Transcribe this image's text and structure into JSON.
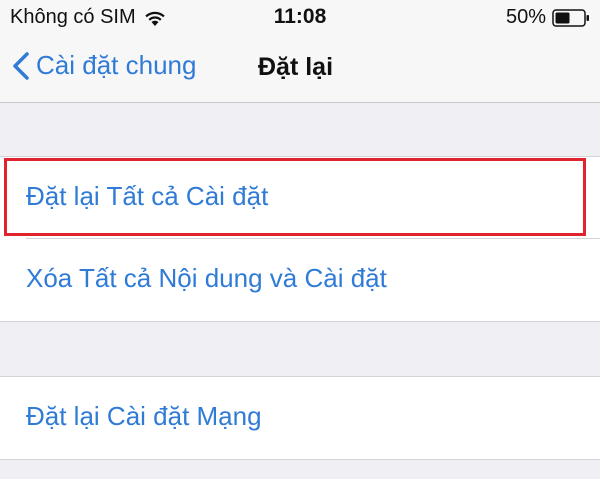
{
  "status_bar": {
    "carrier": "Không có SIM",
    "time": "11:08",
    "battery": "50%",
    "wifi_icon": "wifi-icon",
    "battery_icon": "battery-icon"
  },
  "nav": {
    "back_label": "Cài đặt chung",
    "title": "Đặt lại",
    "back_icon": "chevron-left-icon"
  },
  "groups": [
    {
      "items": [
        {
          "label": "Đặt lại Tất cả Cài đặt",
          "highlighted": true
        },
        {
          "label": "Xóa Tất cả Nội dung và Cài đặt",
          "highlighted": false
        }
      ]
    },
    {
      "items": [
        {
          "label": "Đặt lại Cài đặt Mạng",
          "highlighted": false
        }
      ]
    }
  ],
  "colors": {
    "accent": "#2f7bd6",
    "highlight_border": "#e0242f",
    "background": "#efeff4",
    "cell": "#ffffff",
    "separator": "#d4d3d8"
  }
}
